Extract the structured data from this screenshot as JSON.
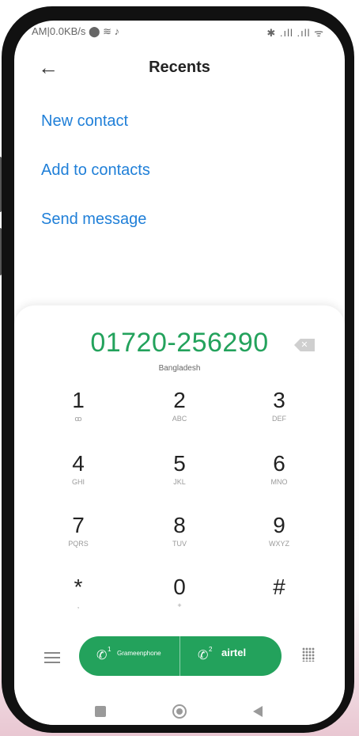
{
  "status_bar": {
    "left": "AM|0.0KB/s ⬤ ≋ ♪",
    "right": "✱ .ıll .ıll ᯤ"
  },
  "header": {
    "back_icon": "←",
    "title": "Recents"
  },
  "actions": {
    "new_contact": "New contact",
    "add_to_contacts": "Add to contacts",
    "send_message": "Send message"
  },
  "dialer": {
    "number": "01720-256290",
    "country": "Bangladesh",
    "backspace_icon": "✕",
    "keys": [
      {
        "digit": "1",
        "letters": "ꝏ"
      },
      {
        "digit": "2",
        "letters": "ABC"
      },
      {
        "digit": "3",
        "letters": "DEF"
      },
      {
        "digit": "4",
        "letters": "GHI"
      },
      {
        "digit": "5",
        "letters": "JKL"
      },
      {
        "digit": "6",
        "letters": "MNO"
      },
      {
        "digit": "7",
        "letters": "PQRS"
      },
      {
        "digit": "8",
        "letters": "TUV"
      },
      {
        "digit": "9",
        "letters": "WXYZ"
      },
      {
        "digit": "*",
        "letters": ","
      },
      {
        "digit": "0",
        "letters": "+"
      },
      {
        "digit": "#",
        "letters": ""
      }
    ]
  },
  "call_buttons": {
    "sim1": {
      "sim": "1",
      "carrier": "Grameenphone"
    },
    "sim2": {
      "sim": "2",
      "carrier": "airtel"
    }
  },
  "colors": {
    "accent_green": "#23a25c",
    "link_blue": "#1f7fd8"
  }
}
